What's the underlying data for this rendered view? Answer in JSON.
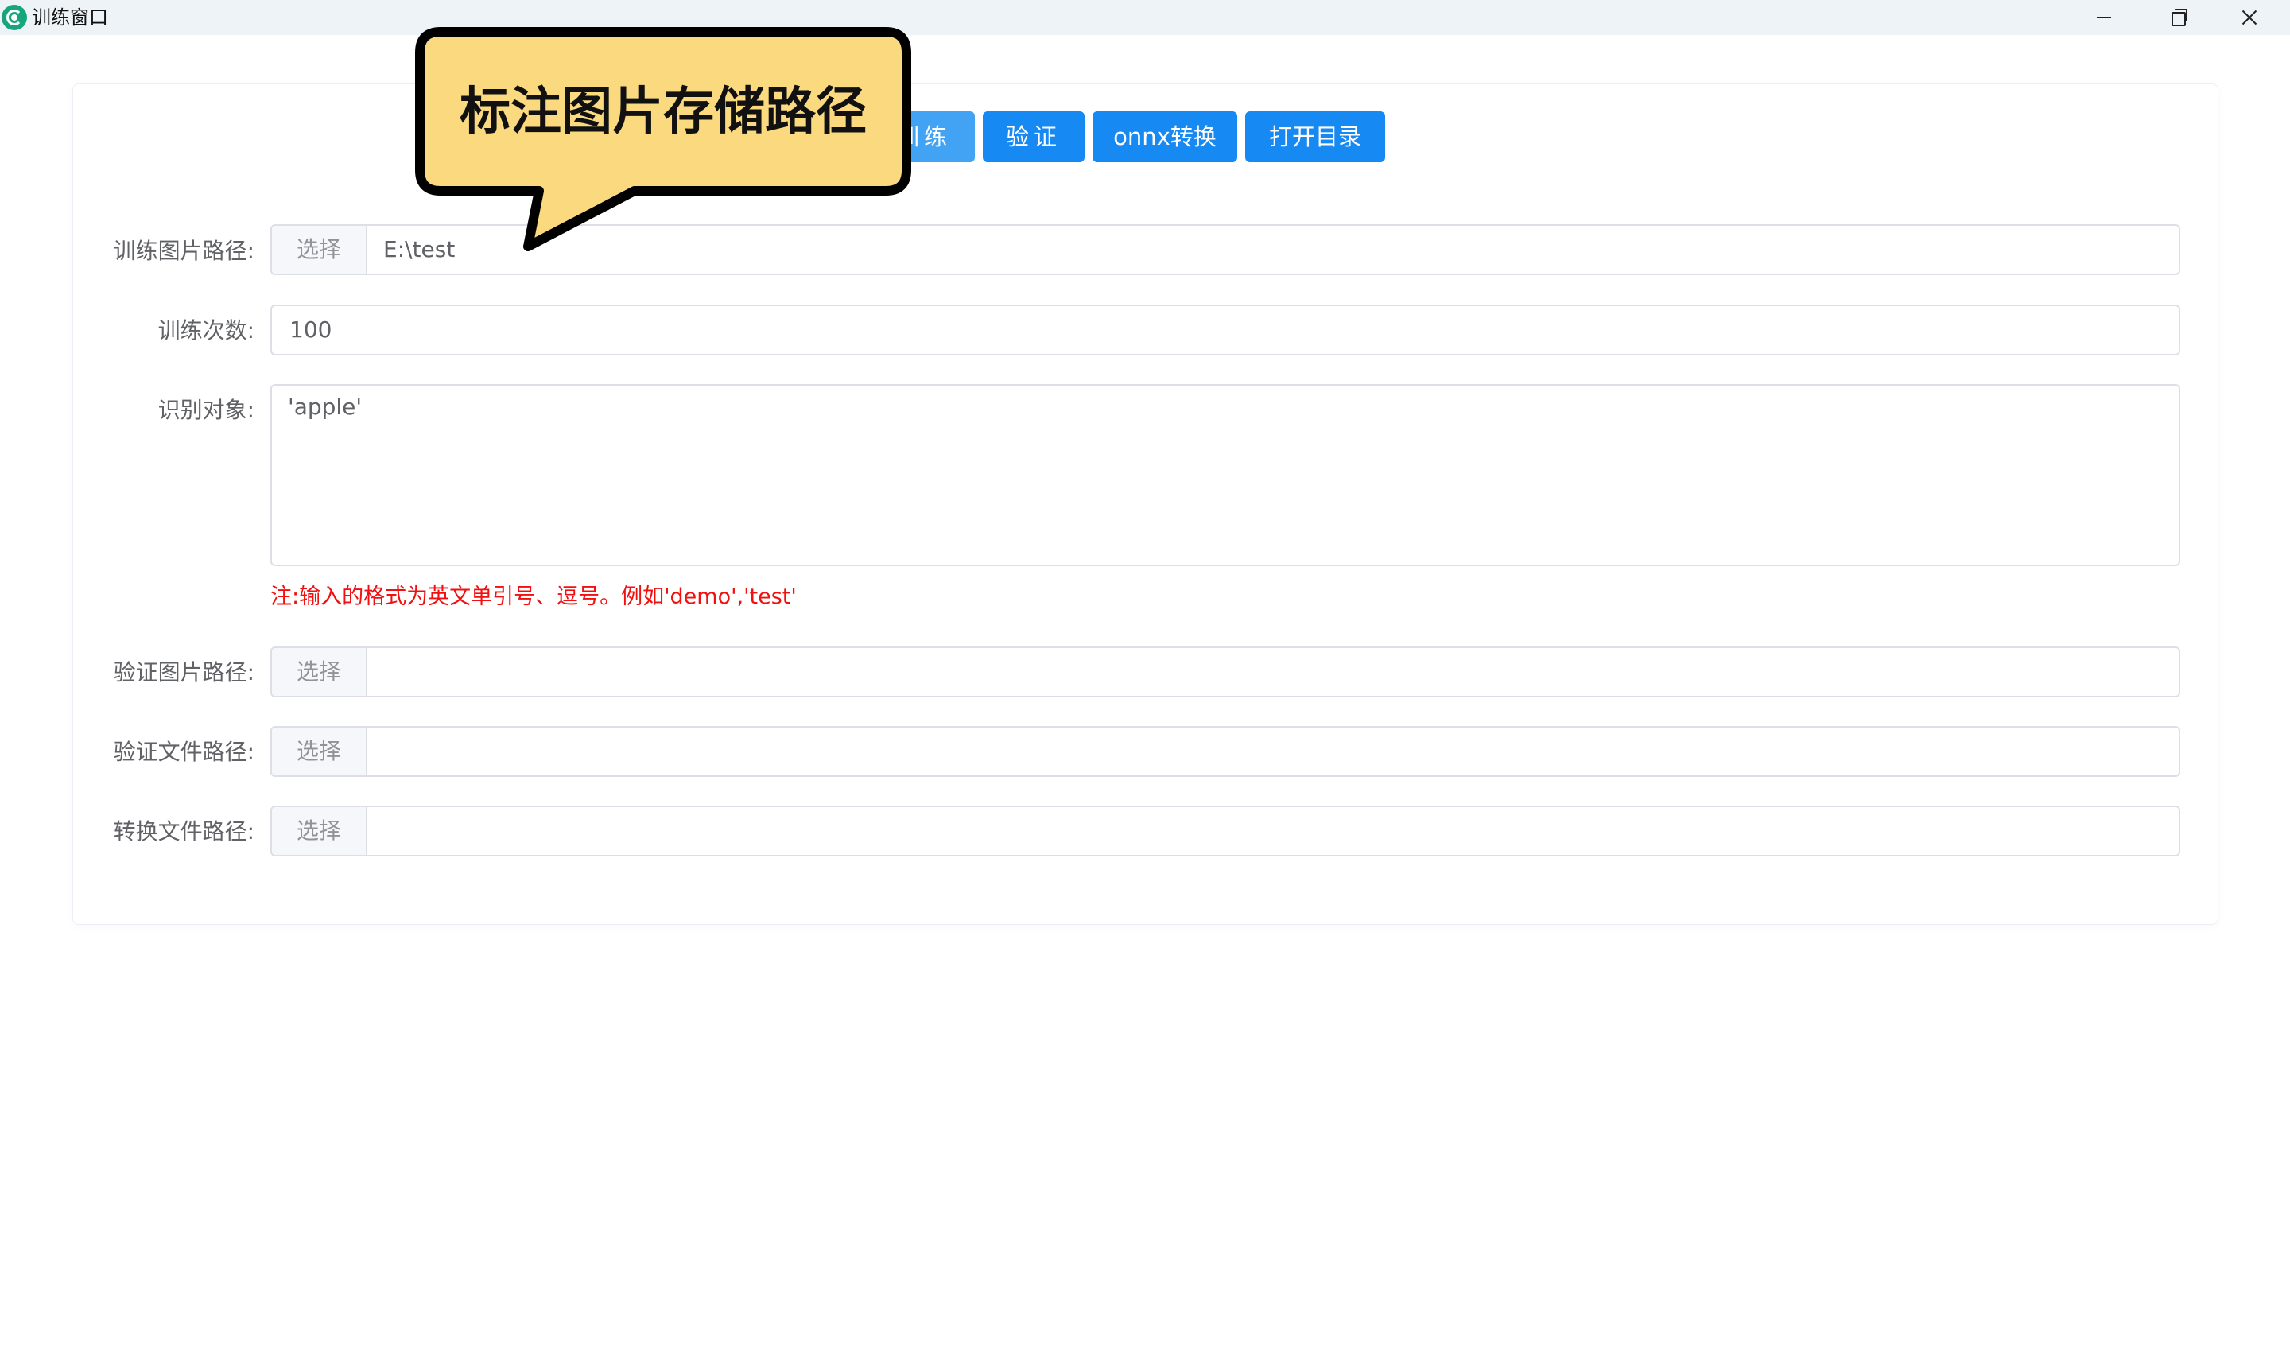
{
  "window": {
    "title": "训练窗口",
    "icon": "app-logo-icon"
  },
  "toolbar": {
    "train_label": "训练",
    "verify_label": "验证",
    "onnx_label": "onnx转换",
    "open_dir_label": "打开目录",
    "primary_color": "#1789f2"
  },
  "form": {
    "train_path": {
      "label": "训练图片路径:",
      "button": "选择",
      "value": "E:\\test"
    },
    "epochs": {
      "label": "训练次数:",
      "value": "100"
    },
    "objects": {
      "label": "识别对象:",
      "value": "'apple'",
      "note": "注:输入的格式为英文单引号、逗号。例如'demo','test'",
      "note_color": "#f10f0f"
    },
    "verify_image_path": {
      "label": "验证图片路径:",
      "button": "选择",
      "value": ""
    },
    "verify_file_path": {
      "label": "验证文件路径:",
      "button": "选择",
      "value": ""
    },
    "convert_file_path": {
      "label": "转换文件路径:",
      "button": "选择",
      "value": ""
    }
  },
  "callout": {
    "text": "标注图片存储路径",
    "fill_color": "#fbd97f"
  }
}
